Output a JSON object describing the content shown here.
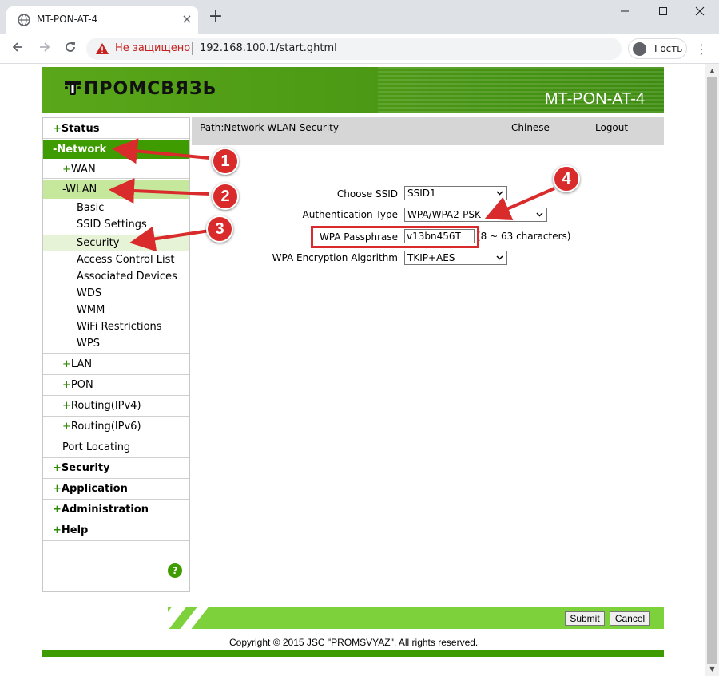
{
  "browser": {
    "tab_title": "MT-PON-AT-4",
    "security_warning": "Не защищено",
    "url": "192.168.100.1/start.ghtml",
    "profile_label": "Гость",
    "icons": [
      "globe-icon",
      "close-icon",
      "plus-icon",
      "minimize-icon",
      "maximize-icon",
      "back-icon",
      "forward-icon",
      "reload-icon",
      "warning-icon",
      "user-icon",
      "menu-icon"
    ]
  },
  "header": {
    "logo_text": "ПРОМСВЯЗЬ",
    "model": "MT-PON-AT-4",
    "colors": {
      "green": "#3f9c00",
      "light_green": "#7dd13a"
    }
  },
  "path": {
    "text": "Path:Network-WLAN-Security",
    "chinese_link": "Chinese",
    "logout_link": "Logout"
  },
  "sidebar": {
    "status": {
      "sign": "+",
      "label": "Status"
    },
    "network": {
      "sign": "-",
      "label": "Network"
    },
    "wan": {
      "sign": "+",
      "label": "WAN"
    },
    "wlan": {
      "sign": "-",
      "label": "WLAN"
    },
    "wlan_items": {
      "basic": "Basic",
      "ssid_settings": "SSID Settings",
      "security": "Security",
      "access_control": "Access Control List",
      "associated": "Associated Devices",
      "wds": "WDS",
      "wmm": "WMM",
      "wifi_restrictions": "WiFi Restrictions",
      "wps": "WPS"
    },
    "lan": {
      "sign": "+",
      "label": "LAN"
    },
    "pon": {
      "sign": "+",
      "label": "PON"
    },
    "routing_v4": {
      "sign": "+",
      "label": "Routing(IPv4)"
    },
    "routing_v6": {
      "sign": "+",
      "label": "Routing(IPv6)"
    },
    "port_locating": "Port Locating",
    "security": {
      "sign": "+",
      "label": "Security"
    },
    "application": {
      "sign": "+",
      "label": "Application"
    },
    "administration": {
      "sign": "+",
      "label": "Administration"
    },
    "help": {
      "sign": "+",
      "label": "Help"
    },
    "help_icon": "?"
  },
  "form": {
    "ssid_label": "Choose SSID",
    "ssid_value": "SSID1",
    "auth_label": "Authentication Type",
    "auth_value": "WPA/WPA2-PSK",
    "passphrase_label": "WPA Passphrase",
    "passphrase_value": "v13bn456T",
    "passphrase_hint": "(8 ~ 63 characters)",
    "encryption_label": "WPA Encryption Algorithm",
    "encryption_value": "TKIP+AES"
  },
  "buttons": {
    "submit": "Submit",
    "cancel": "Cancel"
  },
  "footer": {
    "copyright": "Copyright © 2015 JSC \"PROMSVYAZ\". All rights reserved."
  },
  "annotations": {
    "badge1": "1",
    "badge2": "2",
    "badge3": "3",
    "badge4": "4",
    "color": "#d92b2b"
  }
}
